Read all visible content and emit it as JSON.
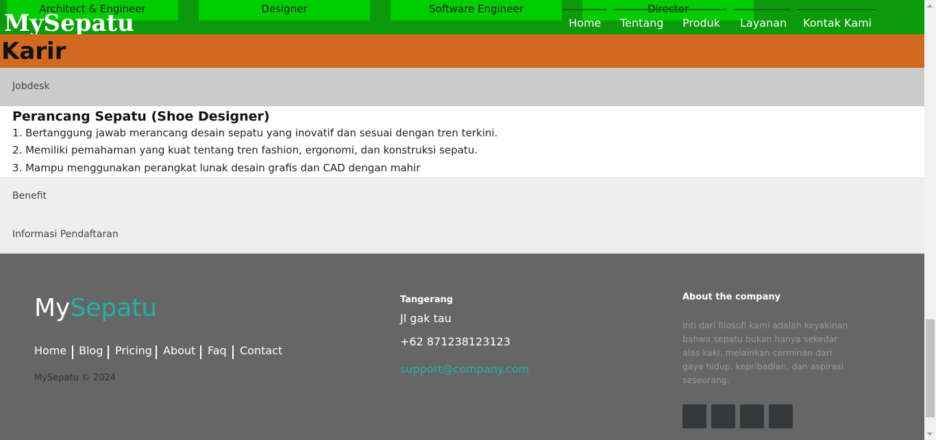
{
  "header": {
    "brand": "MySepatu",
    "job_tabs": [
      "Architect & Engineer",
      "Designer",
      "Software Engineer",
      "Director"
    ],
    "nav": [
      "Home",
      "Tentang",
      "Produk",
      "Layanan",
      "Kontak Kami"
    ],
    "colors": {
      "bar": "#0a9a0a",
      "tab": "#00cc00"
    }
  },
  "page": {
    "title": "Karir",
    "title_bar_color": "#d2691e"
  },
  "accordion": {
    "sections": [
      "Jobdesk",
      "Benefit",
      "Informasi Pendaftaran"
    ],
    "open_section": "Jobdesk",
    "job_title": "Perancang Sepatu (Shoe Designer)",
    "items": [
      "1. Bertanggung jawab merancang desain sepatu yang inovatif dan sesuai dengan tren terkini.",
      "2. Memiliki pemahaman yang kuat tentang tren fashion, ergonomi, dan konstruksi sepatu.",
      "3. Mampu menggunakan perangkat lunak desain grafis dan CAD dengan mahir"
    ]
  },
  "footer": {
    "logo_part1": "My",
    "logo_part2": "Sepatu",
    "links": [
      "Home",
      "Blog",
      "Pricing",
      "About",
      "Faq",
      "Contact"
    ],
    "copyright": "MySepatu © 2024",
    "city": "Tangerang",
    "address": "Jl gak tau",
    "phone": "+62 871238123123",
    "email": "support@company.com",
    "about_title": "About the company",
    "about_text": "Inti dari filosofi kami adalah keyakinan bahwa sepatu bukan hanya sekedar alas kaki, melainkan cerminan dari gaya hidup, kepribadian, dan aspirasi seseorang.",
    "social_icons": [
      "social-icon-1",
      "social-icon-2",
      "social-icon-3",
      "social-icon-4"
    ],
    "colors": {
      "background": "#666666",
      "accent": "#20b2aa"
    }
  }
}
